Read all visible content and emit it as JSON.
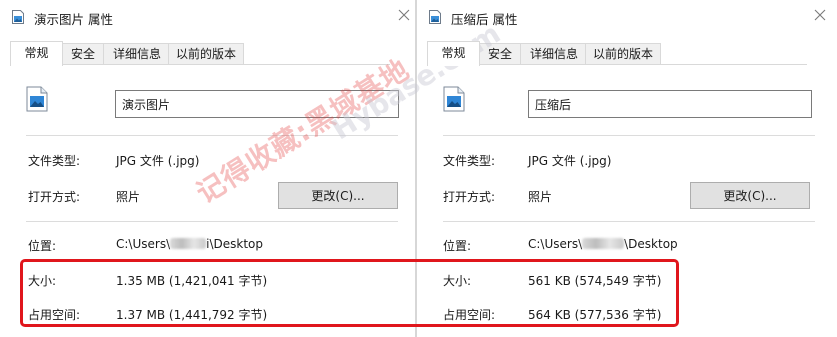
{
  "left_window": {
    "title": "演示图片 属性",
    "tabs": [
      {
        "label": "常规"
      },
      {
        "label": "安全"
      },
      {
        "label": "详细信息"
      },
      {
        "label": "以前的版本"
      }
    ],
    "filename": "演示图片",
    "file_type_label": "文件类型:",
    "file_type_value": "JPG 文件 (.jpg)",
    "open_with_label": "打开方式:",
    "open_with_value": "照片",
    "change_button": "更改(C)...",
    "location_label": "位置:",
    "location_prefix": "C:\\Users\\",
    "location_suffix": "i\\Desktop",
    "size_label": "大小:",
    "size_value": "1.35 MB (1,421,041 字节)",
    "disk_size_label": "占用空间:",
    "disk_size_value": "1.37 MB (1,441,792 字节)"
  },
  "right_window": {
    "title": "压缩后 属性",
    "tabs": [
      {
        "label": "常规"
      },
      {
        "label": "安全"
      },
      {
        "label": "详细信息"
      },
      {
        "label": "以前的版本"
      }
    ],
    "filename": "压缩后",
    "file_type_label": "文件类型:",
    "file_type_value": "JPG 文件 (.jpg)",
    "open_with_label": "打开方式:",
    "open_with_value": "照片",
    "change_button": "更改(C)...",
    "location_label": "位置:",
    "location_prefix": "C:\\Users\\",
    "location_suffix": "\\Desktop",
    "size_label": "大小:",
    "size_value": "561 KB (574,549 字节)",
    "disk_size_label": "占用空间:",
    "disk_size_value": "564 KB (577,536 字节)"
  },
  "watermark": {
    "text": "记得收藏:黑域基地",
    "subtext": "Hybase.com"
  },
  "colors": {
    "highlight": "#e0161c",
    "active_tab_bg": "#ffffff",
    "inactive_tab_bg": "#f0f0f0",
    "button_bg": "#e1e1e1"
  },
  "icons": {
    "app": "image-file-icon",
    "close": "close-icon"
  }
}
